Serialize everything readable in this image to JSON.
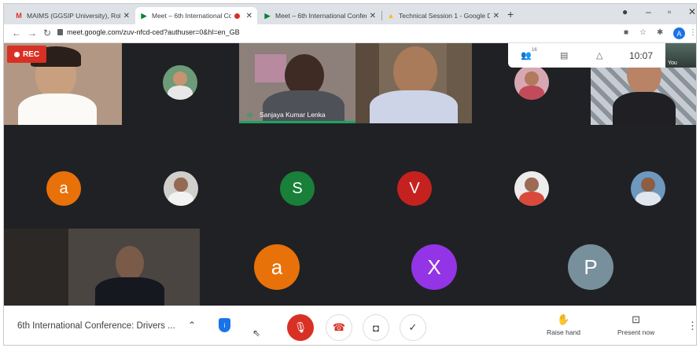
{
  "browser": {
    "tabs": [
      {
        "label": "MAIMS (GGSIP University), Rohi",
        "icon": "gmail-icon",
        "active": false
      },
      {
        "label": "Meet – 6th International Co",
        "icon": "meet-icon",
        "active": true,
        "recording": true
      },
      {
        "label": "Meet – 6th International Confere",
        "icon": "meet-icon",
        "active": false
      },
      {
        "label": "Technical Session 1 - Google Dri",
        "icon": "drive-icon",
        "active": false
      }
    ],
    "url": "meet.google.com/zuv-nfcd-ced?authuser=0&hl=en_GB",
    "profile_initial": "A"
  },
  "meet": {
    "rec_label": "REC",
    "participant_count": "16",
    "clock": "10:07",
    "self_label": "You",
    "speaker_name": "Sanjaya Kumar Lenka",
    "participants": [
      {
        "type": "video",
        "tone": "#a88b70"
      },
      {
        "type": "photo",
        "tone": "#5f8a6a"
      },
      {
        "type": "video",
        "tone": "#6d6560",
        "name": "Sanjaya Kumar Lenka",
        "speaking": true
      },
      {
        "type": "video",
        "tone": "#7d6f5e"
      },
      {
        "type": "photo",
        "tone": "#c48a98"
      },
      {
        "type": "video",
        "tone": "#8d9298"
      },
      {
        "type": "initial",
        "initial": "a",
        "color": "#e8710a"
      },
      {
        "type": "photo",
        "tone": "#9a9a9a"
      },
      {
        "type": "initial",
        "initial": "S",
        "color": "#188038"
      },
      {
        "type": "initial",
        "initial": "V",
        "color": "#c5221f"
      },
      {
        "type": "photo",
        "tone": "#d6604d"
      },
      {
        "type": "photo",
        "tone": "#4e7fa8"
      },
      {
        "type": "video",
        "tone": "#3a3330"
      },
      {
        "type": "initial",
        "initial": "a",
        "color": "#e8710a"
      },
      {
        "type": "initial",
        "initial": "X",
        "color": "#9334e6"
      },
      {
        "type": "initial",
        "initial": "P",
        "color": "#78909c"
      }
    ]
  },
  "controls": {
    "meeting_title": "6th International Conference: Drivers ...",
    "raise_hand_label": "Raise hand",
    "present_label": "Present now"
  }
}
